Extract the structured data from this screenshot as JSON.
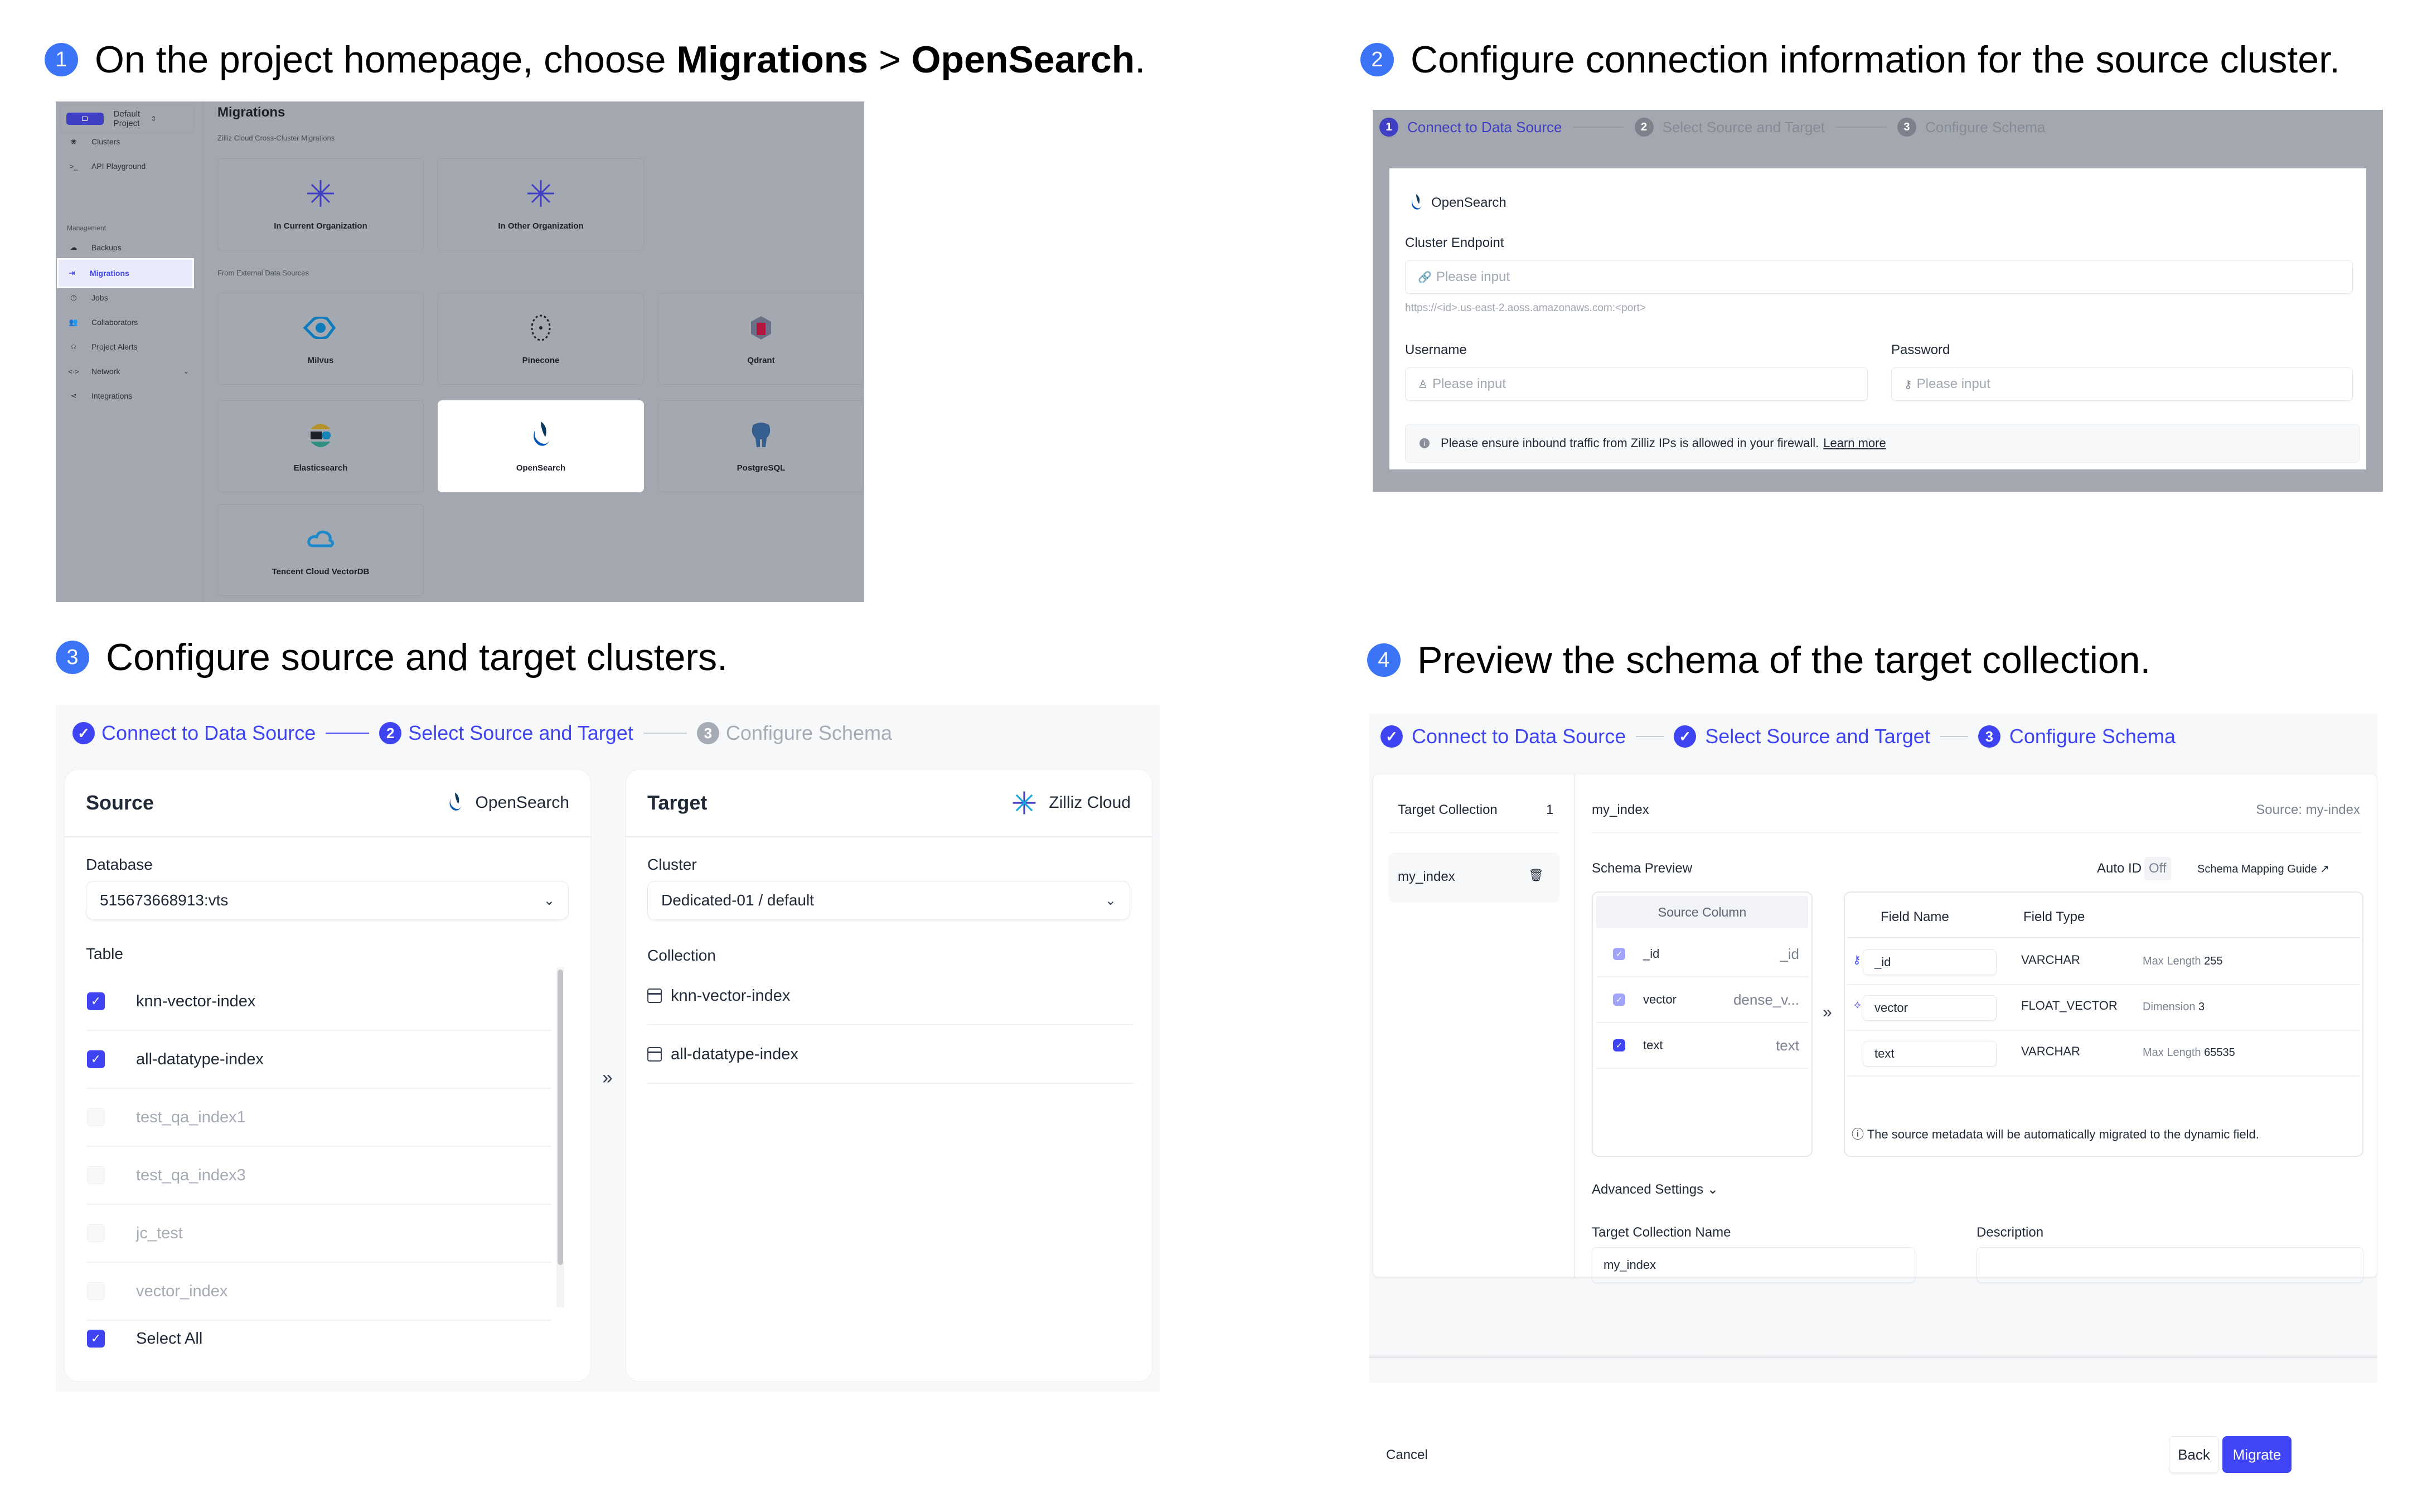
{
  "colors": {
    "accent": "#3f44f3",
    "step_badge": "#3b74f7",
    "overlay": "#a3a8b0",
    "muted_text": "#a6acb6"
  },
  "steps_heading": [
    {
      "num": "1",
      "pre": "On the project homepage, choose ",
      "bold1": "Migrations",
      "sep": " > ",
      "bold2": "OpenSearch",
      "post": "."
    },
    {
      "num": "2",
      "text": "Configure connection information for the source cluster."
    },
    {
      "num": "3",
      "text": "Configure source and target clusters."
    },
    {
      "num": "4",
      "text": "Preview the schema of the target collection."
    }
  ],
  "panel1": {
    "project": "Default Project",
    "nav": [
      {
        "label": "Clusters",
        "icon": "clusters-icon"
      },
      {
        "label": "API Playground",
        "icon": "terminal-icon"
      },
      {
        "label": "Backups",
        "icon": "cloud-upload-icon"
      },
      {
        "label": "Migrations",
        "icon": "migrate-icon",
        "active": true
      },
      {
        "label": "Jobs",
        "icon": "history-icon"
      },
      {
        "label": "Collaborators",
        "icon": "users-icon"
      },
      {
        "label": "Project Alerts",
        "icon": "alarm-icon"
      },
      {
        "label": "Network",
        "icon": "network-icon",
        "expandable": true
      },
      {
        "label": "Integrations",
        "icon": "integrations-icon"
      }
    ],
    "management_label": "Management",
    "page_title": "Migrations",
    "section_cross": "Zilliz Cloud Cross-Cluster Migrations",
    "section_external": "From External Data Sources",
    "cross_cards": [
      "In Current Organization",
      "In Other Organization"
    ],
    "external_cards": [
      "Milvus",
      "Pinecone",
      "Qdrant",
      "Elasticsearch",
      "OpenSearch",
      "PostgreSQL",
      "Tencent Cloud VectorDB"
    ],
    "highlighted_card": "OpenSearch"
  },
  "wizard_steps": [
    "Connect to Data Source",
    "Select Source and Target",
    "Configure Schema"
  ],
  "panel2": {
    "source_name": "OpenSearch",
    "endpoint_label": "Cluster Endpoint",
    "endpoint_placeholder": "Please input",
    "endpoint_hint": "https://<id>.us-east-2.aoss.amazonaws.com:<port>",
    "username_label": "Username",
    "username_placeholder": "Please input",
    "password_label": "Password",
    "password_placeholder": "Please input",
    "notice": "Please ensure inbound traffic from Zilliz IPs is allowed in your firewall.",
    "learn_more": "Learn more"
  },
  "panel3": {
    "source_title": "Source",
    "source_brand": "OpenSearch",
    "database_label": "Database",
    "database_value": "515673668913:vts",
    "table_label": "Table",
    "tables": [
      {
        "name": "knn-vector-index",
        "checked": true
      },
      {
        "name": "all-datatype-index",
        "checked": true
      },
      {
        "name": "test_qa_index1",
        "checked": false
      },
      {
        "name": "test_qa_index3",
        "checked": false
      },
      {
        "name": "jc_test",
        "checked": false
      },
      {
        "name": "vector_index",
        "checked": false
      }
    ],
    "select_all": "Select All",
    "target_title": "Target",
    "target_brand": "Zilliz Cloud",
    "cluster_label": "Cluster",
    "cluster_value": "Dedicated-01 / default",
    "collection_label": "Collection",
    "collections": [
      "knn-vector-index",
      "all-datatype-index"
    ]
  },
  "panel4": {
    "target_collection_label": "Target Collection",
    "target_collection_count": "1",
    "collection_item": "my_index",
    "collection_name": "my_index",
    "source_ref": "Source: my-index",
    "schema_preview": "Schema Preview",
    "auto_id_label": "Auto ID",
    "auto_id_value": "Off",
    "mapping_guide": "Schema Mapping Guide",
    "source_column_header": "Source Column",
    "field_name_header": "Field Name",
    "field_type_header": "Field Type",
    "rows": [
      {
        "source": "_id",
        "source_type": "_id",
        "field": "_id",
        "type": "VARCHAR",
        "param_label": "Max Length",
        "param_value": "255",
        "icon": "primary-key-icon",
        "checkbox": "locked"
      },
      {
        "source": "vector",
        "source_type": "dense_v...",
        "field": "vector",
        "type": "FLOAT_VECTOR",
        "param_label": "Dimension",
        "param_value": "3",
        "icon": "vector-icon",
        "checkbox": "locked"
      },
      {
        "source": "text",
        "source_type": "text",
        "field": "text",
        "type": "VARCHAR",
        "param_label": "Max Length",
        "param_value": "65535",
        "icon": "",
        "checkbox": "on"
      }
    ],
    "dynamic_note": "The source metadata will be automatically migrated to the dynamic field.",
    "advanced": "Advanced Settings",
    "tcn_label": "Target Collection Name",
    "tcn_value": "my_index",
    "desc_label": "Description",
    "desc_value": "",
    "cancel": "Cancel",
    "back": "Back",
    "migrate": "Migrate"
  }
}
